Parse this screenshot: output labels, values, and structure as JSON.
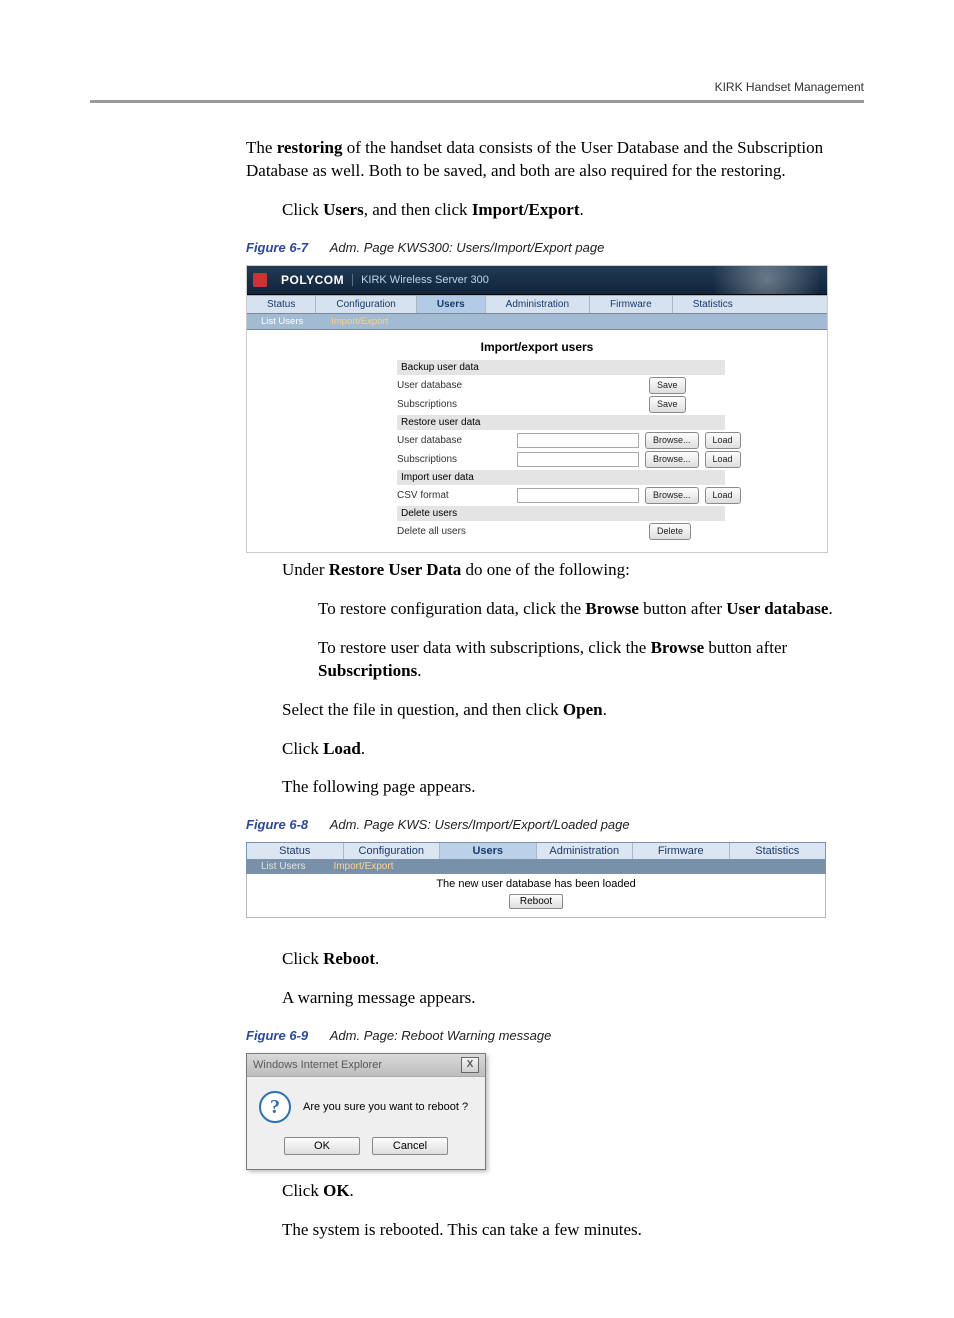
{
  "header": {
    "running": "KIRK Handset Management"
  },
  "p": {
    "p1a": "The ",
    "p1b": "restoring",
    "p1c": " of the handset data consists of the User Database and the Subscription Database as well. Both to be saved, and both are also required for the restoring.",
    "p2a": "Click ",
    "p2b": "Users",
    "p2c": ", and then click ",
    "p2d": "Import/Export",
    "p2e": ".",
    "p3a": "Under ",
    "p3b": "Restore User Data",
    "p3c": " do one of the following:",
    "p4a": "To restore configuration data, click the ",
    "p4b": "Browse",
    "p4c": " button after ",
    "p4d": "User database",
    "p4e": ".",
    "p5a": "To restore user data with subscriptions, click the ",
    "p5b": "Browse",
    "p5c": " button after ",
    "p5d": "Subscriptions",
    "p5e": ".",
    "p6a": "Select the file in question, and then click ",
    "p6b": "Open",
    "p6c": ".",
    "p7a": "Click ",
    "p7b": "Load",
    "p7c": ".",
    "p8": "The following page appears.",
    "p9a": "Click ",
    "p9b": "Reboot",
    "p9c": ".",
    "p10": "A warning message appears.",
    "p11a": "Click ",
    "p11b": "OK",
    "p11c": ".",
    "p12": "The system is rebooted. This can take a few minutes."
  },
  "fig67": {
    "label": "Figure 6-7",
    "title": "Adm. Page KWS300: Users/Import/Export page",
    "brand": "POLYCOM",
    "product": "KIRK Wireless Server 300",
    "tabs": [
      "Status",
      "Configuration",
      "Users",
      "Administration",
      "Firmware",
      "Statistics"
    ],
    "subtabs": [
      "List Users",
      "Import/Export"
    ],
    "pageTitle": "Import/export users",
    "sec_backup": "Backup user data",
    "row_ud": "User database",
    "row_sub": "Subscriptions",
    "btn_save": "Save",
    "sec_restore": "Restore user data",
    "btn_browse": "Browse...",
    "btn_load": "Load",
    "sec_import": "Import user data",
    "row_csv": "CSV format",
    "sec_delete": "Delete users",
    "row_delall": "Delete all users",
    "btn_delete": "Delete"
  },
  "fig68": {
    "label": "Figure 6-8",
    "title": "Adm. Page KWS: Users/Import/Export/Loaded page",
    "tabs": [
      "Status",
      "Configuration",
      "Users",
      "Administration",
      "Firmware",
      "Statistics"
    ],
    "subtabs": [
      "List Users",
      "Import/Export"
    ],
    "msg": "The new user database has been loaded",
    "btn": "Reboot"
  },
  "fig69": {
    "label": "Figure 6-9",
    "title": "Adm. Page: Reboot Warning message",
    "winTitle": "Windows Internet Explorer",
    "close": "X",
    "msg": "Are you sure you want to reboot ?",
    "ok": "OK",
    "cancel": "Cancel"
  }
}
